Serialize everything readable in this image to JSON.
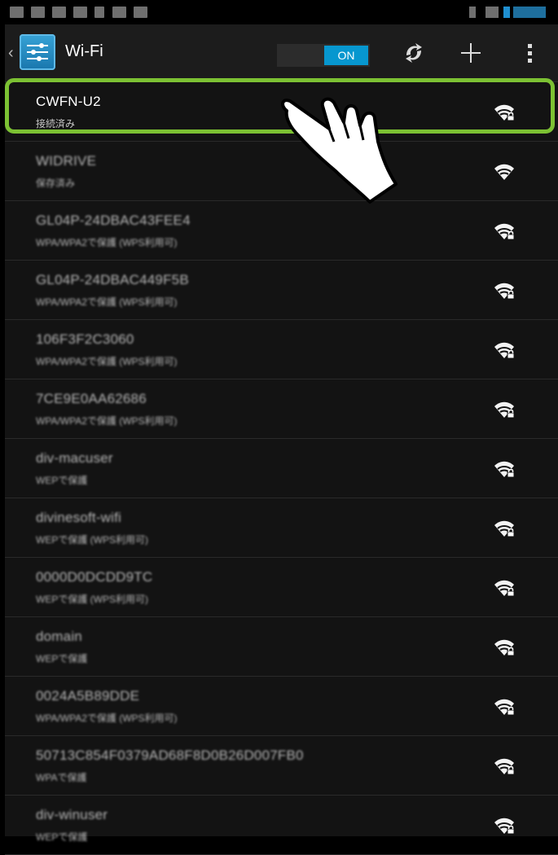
{
  "actionbar": {
    "title": "Wi-Fi",
    "toggle_label": "ON"
  },
  "icons": {
    "app": "wifi-settings-icon",
    "wps": "wps-icon",
    "add": "add-icon",
    "overflow": "overflow-menu-icon"
  },
  "networks": [
    {
      "ssid": "CWFN-U2",
      "status": "接続済み",
      "secured": true
    },
    {
      "ssid": "WIDRIVE",
      "status": "保存済み",
      "secured": false
    },
    {
      "ssid": "GL04P-24DBAC43FEE4",
      "status": "WPA/WPA2で保護 (WPS利用可)",
      "secured": true
    },
    {
      "ssid": "GL04P-24DBAC449F5B",
      "status": "WPA/WPA2で保護 (WPS利用可)",
      "secured": true
    },
    {
      "ssid": "106F3F2C3060",
      "status": "WPA/WPA2で保護 (WPS利用可)",
      "secured": true
    },
    {
      "ssid": "7CE9E0AA62686",
      "status": "WPA/WPA2で保護 (WPS利用可)",
      "secured": true
    },
    {
      "ssid": "div-macuser",
      "status": "WEPで保護",
      "secured": true
    },
    {
      "ssid": "divinesoft-wifi",
      "status": "WEPで保護 (WPS利用可)",
      "secured": true
    },
    {
      "ssid": "0000D0DCDD9TC",
      "status": "WEPで保護 (WPS利用可)",
      "secured": true
    },
    {
      "ssid": "domain",
      "status": "WEPで保護",
      "secured": true
    },
    {
      "ssid": "0024A5B89DDE",
      "status": "WPA/WPA2で保護 (WPS利用可)",
      "secured": true
    },
    {
      "ssid": "50713C854F0379AD68F8D0B26D007FB0",
      "status": "WPAで保護",
      "secured": true
    },
    {
      "ssid": "div-winuser",
      "status": "WEPで保護",
      "secured": true
    }
  ],
  "accent": "#7cc133",
  "toggle_color": "#0797cf"
}
